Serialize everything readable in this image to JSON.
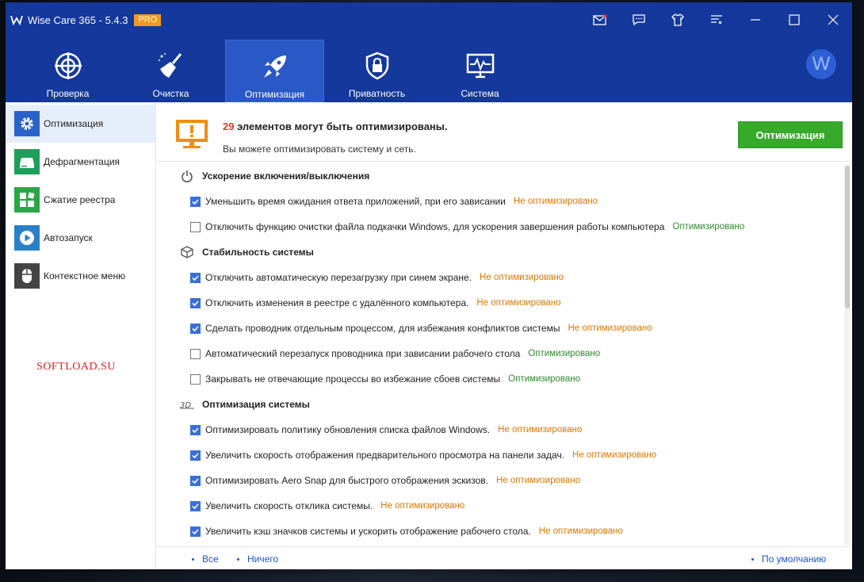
{
  "window": {
    "title": "Wise Care 365 - 5.4.3",
    "badge": "PRO"
  },
  "titlebar_icons": [
    "mail-icon",
    "feedback-icon",
    "skin-icon",
    "menu-icon",
    "minimize-icon",
    "maximize-icon",
    "close-icon"
  ],
  "nav": {
    "tabs": [
      {
        "label": "Проверка",
        "icon": "scan-icon"
      },
      {
        "label": "Очистка",
        "icon": "broom-icon"
      },
      {
        "label": "Оптимизация",
        "icon": "rocket-icon",
        "active": true
      },
      {
        "label": "Приватность",
        "icon": "lock-icon"
      },
      {
        "label": "Система",
        "icon": "monitor-pulse-icon"
      }
    ],
    "avatar_letter": "W"
  },
  "sidebar": {
    "items": [
      {
        "label": "Оптимизация",
        "icon": "gear-icon",
        "active": true,
        "color": "#2a62c9"
      },
      {
        "label": "Дефрагментация",
        "icon": "disk-icon",
        "color": "#1e9e5a"
      },
      {
        "label": "Сжатие реестра",
        "icon": "registry-icon",
        "color": "#28a745"
      },
      {
        "label": "Автозапуск",
        "icon": "play-icon",
        "color": "#2a7fc9"
      },
      {
        "label": "Контекстное меню",
        "icon": "mouse-icon",
        "color": "#444444"
      }
    ],
    "watermark": "SOFTLOAD.SU"
  },
  "summary": {
    "count": "29",
    "title_rest": " элементов могут быть оптимизированы.",
    "subtitle": "Вы можете оптимизировать систему и сеть.",
    "button": "Оптимизация"
  },
  "sections": [
    {
      "title": "Ускорение включения/выключения",
      "icon": "power-icon",
      "items": [
        {
          "label": "Уменьшить время ожидания ответа приложений, при его зависании",
          "checked": true,
          "status": "Не оптимизировано",
          "state": "bad"
        },
        {
          "label": "Отключить функцию очистки файла подкачки Windows, для ускорения завершения работы компьютера",
          "checked": false,
          "status": "Оптимизировано",
          "state": "good"
        }
      ]
    },
    {
      "title": "Стабильность системы",
      "icon": "cube-icon",
      "items": [
        {
          "label": "Отключить автоматическую перезагрузку при синем экране.",
          "checked": true,
          "status": "Не оптимизировано",
          "state": "bad"
        },
        {
          "label": "Отключить изменения в реестре с удалённого компьютера.",
          "checked": true,
          "status": "Не оптимизировано",
          "state": "bad"
        },
        {
          "label": "Сделать проводник отдельным процессом, для избежания конфликтов системы",
          "checked": true,
          "status": "Не оптимизировано",
          "state": "bad"
        },
        {
          "label": "Автоматический перезапуск проводника при зависании рабочего стола",
          "checked": false,
          "status": "Оптимизировано",
          "state": "good"
        },
        {
          "label": "Закрывать не отвечающие процессы во избежание сбоев системы",
          "checked": false,
          "status": "Оптимизировано",
          "state": "good"
        }
      ]
    },
    {
      "title": "Оптимизация системы",
      "icon": "3d-icon",
      "items": [
        {
          "label": "Оптимизировать политику обновления списка файлов Windows.",
          "checked": true,
          "status": "Не оптимизировано",
          "state": "bad"
        },
        {
          "label": "Увеличить скорость отображения предварительного просмотра на панели задач.",
          "checked": true,
          "status": "Не оптимизировано",
          "state": "bad"
        },
        {
          "label": "Оптимизировать Aero Snap для быстрого отображения эскизов.",
          "checked": true,
          "status": "Не оптимизировано",
          "state": "bad"
        },
        {
          "label": "Увеличить скорость отклика системы.",
          "checked": true,
          "status": "Не оптимизировано",
          "state": "bad"
        },
        {
          "label": "Увеличить кэш значков системы и ускорить отображение рабочего стола.",
          "checked": true,
          "status": "Не оптимизировано",
          "state": "bad"
        }
      ]
    }
  ],
  "footer": {
    "all": "Все",
    "none": "Ничего",
    "default": "По умолчанию"
  },
  "colors": {
    "header": "#14389b",
    "active_tab": "#2a58c7",
    "primary_button": "#37a92b",
    "not_optimized": "#e07800",
    "optimized": "#2e8b2e",
    "count": "#e03a2b"
  }
}
